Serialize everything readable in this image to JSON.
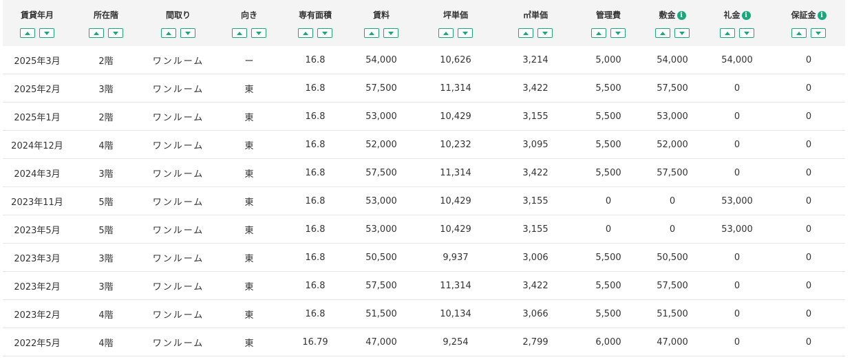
{
  "columns": [
    {
      "label": "賃貸年月",
      "info": false
    },
    {
      "label": "所在階",
      "info": false
    },
    {
      "label": "間取り",
      "info": false
    },
    {
      "label": "向き",
      "info": false
    },
    {
      "label": "専有面積",
      "info": false
    },
    {
      "label": "賃料",
      "info": false
    },
    {
      "label": "坪単価",
      "info": false
    },
    {
      "label": "㎡単価",
      "info": false
    },
    {
      "label": "管理費",
      "info": false
    },
    {
      "label": "敷金",
      "info": true
    },
    {
      "label": "礼金",
      "info": true
    },
    {
      "label": "保証金",
      "info": true
    }
  ],
  "info_glyph": "i",
  "accent_color": "#19a87a",
  "sort_icons": {
    "asc": "sort-ascending-icon",
    "desc": "sort-descending-icon"
  },
  "rows": [
    [
      "2025年3月",
      "2階",
      "ワンルーム",
      "ー",
      "16.8",
      "54,000",
      "10,626",
      "3,214",
      "5,000",
      "54,000",
      "54,000",
      "0"
    ],
    [
      "2025年2月",
      "3階",
      "ワンルーム",
      "東",
      "16.8",
      "57,500",
      "11,314",
      "3,422",
      "5,500",
      "57,500",
      "0",
      "0"
    ],
    [
      "2025年1月",
      "2階",
      "ワンルーム",
      "東",
      "16.8",
      "53,000",
      "10,429",
      "3,155",
      "5,500",
      "53,000",
      "0",
      "0"
    ],
    [
      "2024年12月",
      "4階",
      "ワンルーム",
      "東",
      "16.8",
      "52,000",
      "10,232",
      "3,095",
      "5,500",
      "52,000",
      "0",
      "0"
    ],
    [
      "2024年3月",
      "3階",
      "ワンルーム",
      "東",
      "16.8",
      "57,500",
      "11,314",
      "3,422",
      "5,500",
      "57,500",
      "0",
      "0"
    ],
    [
      "2023年11月",
      "5階",
      "ワンルーム",
      "東",
      "16.8",
      "53,000",
      "10,429",
      "3,155",
      "0",
      "0",
      "53,000",
      "0"
    ],
    [
      "2023年5月",
      "5階",
      "ワンルーム",
      "東",
      "16.8",
      "53,000",
      "10,429",
      "3,155",
      "0",
      "0",
      "53,000",
      "0"
    ],
    [
      "2023年3月",
      "3階",
      "ワンルーム",
      "東",
      "16.8",
      "50,500",
      "9,937",
      "3,006",
      "5,500",
      "50,500",
      "0",
      "0"
    ],
    [
      "2023年2月",
      "3階",
      "ワンルーム",
      "東",
      "16.8",
      "57,500",
      "11,314",
      "3,422",
      "5,500",
      "57,500",
      "0",
      "0"
    ],
    [
      "2023年2月",
      "4階",
      "ワンルーム",
      "東",
      "16.8",
      "51,500",
      "10,134",
      "3,066",
      "5,500",
      "51,500",
      "0",
      "0"
    ],
    [
      "2022年5月",
      "4階",
      "ワンルーム",
      "東",
      "16.79",
      "47,000",
      "9,254",
      "2,799",
      "6,000",
      "47,000",
      "0",
      "0"
    ]
  ]
}
